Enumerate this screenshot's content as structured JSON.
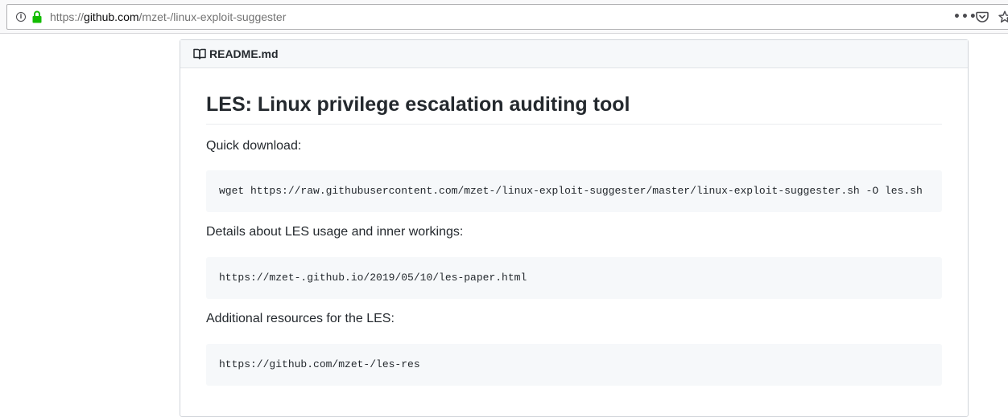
{
  "browser": {
    "url_host_prefix": "https://",
    "url_host": "github.com",
    "url_path": "/mzet-/linux-exploit-suggester",
    "info_icon": "i",
    "more_icon": "•••",
    "icons": [
      "info-icon",
      "lock-icon",
      "more-icon",
      "pocket-icon",
      "star-icon"
    ],
    "lock_color": "#12bc00"
  },
  "readme": {
    "filename": "README.md",
    "icon": "book-icon",
    "title": "LES: Linux privilege escalation auditing tool",
    "sections": [
      {
        "text": "Quick download:",
        "code": "wget https://raw.githubusercontent.com/mzet-/linux-exploit-suggester/master/linux-exploit-suggester.sh -O les.sh"
      },
      {
        "text": "Details about LES usage and inner workings:",
        "code": "https://mzet-.github.io/2019/05/10/les-paper.html"
      },
      {
        "text": "Additional resources for the LES:",
        "code": "https://github.com/mzet-/les-res"
      }
    ]
  }
}
